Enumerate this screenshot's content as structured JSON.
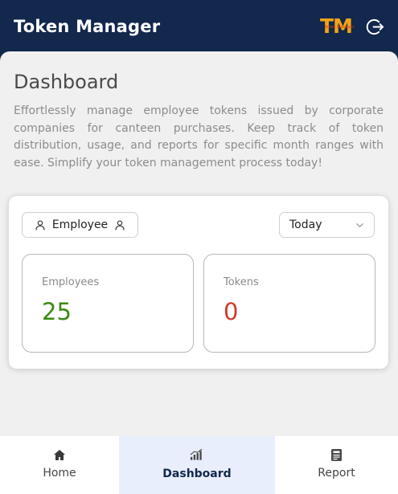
{
  "header": {
    "title": "Token Manager",
    "logo_letters": "TM",
    "logo_subtext": "Token Manager",
    "logout_icon": "logout-icon"
  },
  "main": {
    "title": "Dashboard",
    "intro": "Effortlessly manage employee tokens issued by corporate companies for canteen purchases. Keep track of token distribution, usage, and reports for specific month ranges with ease. Simplify your token management process today!"
  },
  "filters": {
    "employee_label": "Employee",
    "range_selected": "Today"
  },
  "stats": [
    {
      "label": "Employees",
      "value": "25",
      "color": "#3a8a12"
    },
    {
      "label": "Tokens",
      "value": "0",
      "color": "#cf3a2a"
    }
  ],
  "nav": [
    {
      "label": "Home",
      "icon": "home-icon"
    },
    {
      "label": "Dashboard",
      "icon": "bar-chart-icon",
      "active": true
    },
    {
      "label": "Report",
      "icon": "report-icon"
    }
  ],
  "colors": {
    "primary": "#12284d",
    "accent": "#f3a417",
    "active_nav_bg": "#e8eefc"
  }
}
